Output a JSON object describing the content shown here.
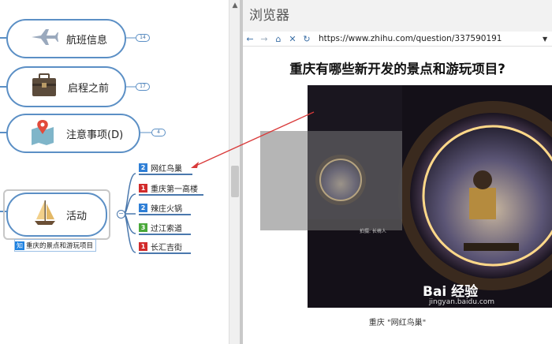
{
  "mindmap": {
    "nodes": [
      {
        "label": "航班信息",
        "count": "14",
        "icon": "airplane-icon"
      },
      {
        "label": "启程之前",
        "count": "17",
        "icon": "briefcase-icon"
      },
      {
        "label": "注意事项(D)",
        "count": "4",
        "icon": "map-pin-icon"
      }
    ],
    "activity": {
      "label": "活动",
      "icon": "sailboat-icon",
      "link_badge": "知",
      "link_text": "重庆的景点和游玩项目"
    },
    "subtopics": [
      {
        "priority": "2",
        "label": "网红鸟巢",
        "color": "#2f7fd6"
      },
      {
        "priority": "1",
        "label": "重庆第一高楼",
        "color": "#d22b2b"
      },
      {
        "priority": "2",
        "label": "辣庄火锅",
        "color": "#2f7fd6"
      },
      {
        "priority": "3",
        "label": "过江索道",
        "color": "#4aa83a"
      },
      {
        "priority": "1",
        "label": "长汇吉街",
        "color": "#d22b2b"
      }
    ]
  },
  "browser": {
    "title": "浏览器",
    "url": "https://www.zhihu.com/question/337590191",
    "question": "重庆有哪些新开发的景点和游玩项目?",
    "caption": "重庆 \"网红鸟巢\"",
    "watermark": "Bai 经验",
    "watermark_sub": "jingyan.baidu.com",
    "small_caption": "拍摄: 长椅人"
  }
}
